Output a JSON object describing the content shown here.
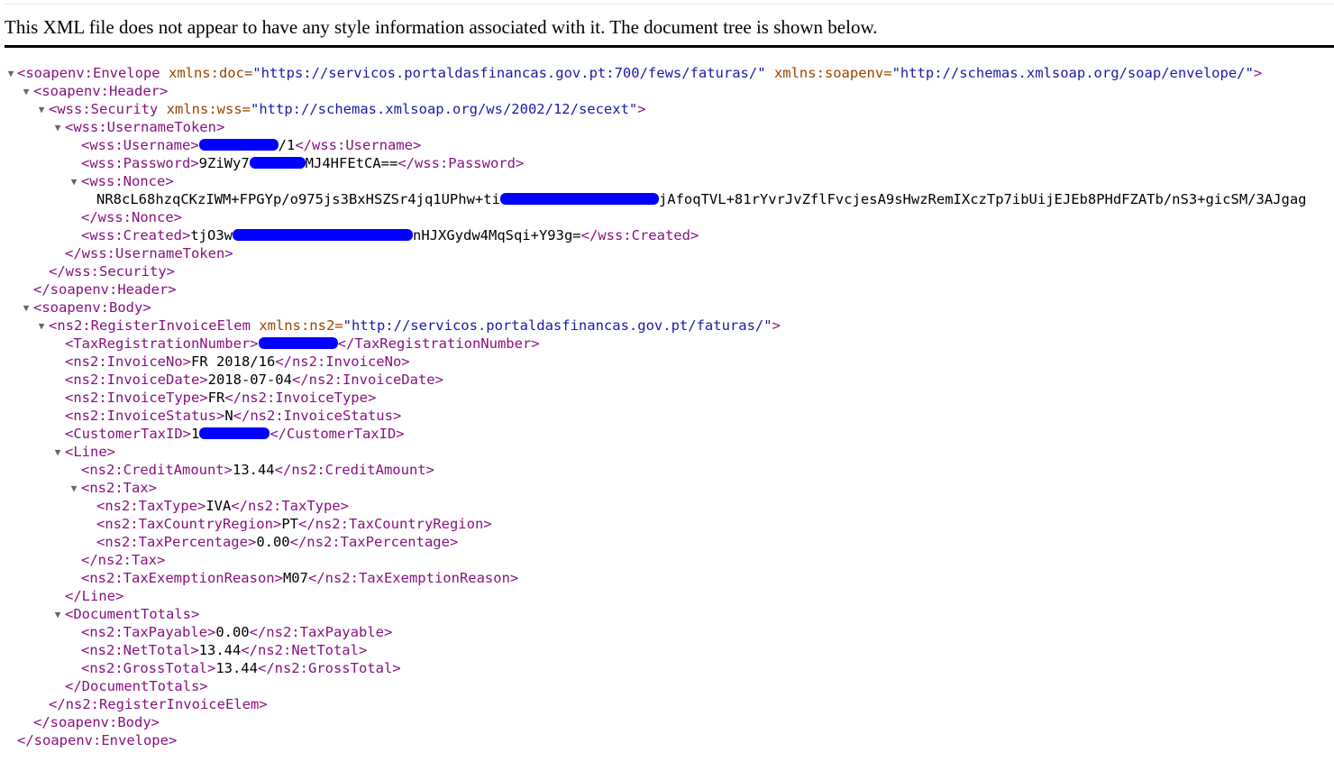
{
  "banner": "This XML file does not appear to have any style information associated with it. The document tree is shown below.",
  "xml": {
    "envelope_open": "<soapenv:Envelope",
    "ns_doc_attr": "xmlns:doc=",
    "ns_doc_val": "\"https://servicos.portaldasfinancas.gov.pt:700/fews/faturas/\"",
    "ns_soapenv_attr": "xmlns:soapenv=",
    "ns_soapenv_val": "\"http://schemas.xmlsoap.org/soap/envelope/\"",
    "gt": ">",
    "header_open": "<soapenv:Header>",
    "security_open": "<wss:Security",
    "ns_wss_attr": "xmlns:wss=",
    "ns_wss_val": "\"http://schemas.xmlsoap.org/ws/2002/12/secext\"",
    "token_open": "<wss:UsernameToken>",
    "username_open": "<wss:Username>",
    "username_suffix": "/1",
    "username_close": "</wss:Username>",
    "password_open": "<wss:Password>",
    "password_prefix": "9ZiWy7",
    "password_suffix": "MJ4HFEtCA==",
    "password_close": "</wss:Password>",
    "nonce_open": "<wss:Nonce>",
    "nonce_prefix": "NR8cL68hzqCKzIWM+FPGYp/o975js3BxHSZSr4jq1UPhw+ti",
    "nonce_suffix": "jAfoqTVL+81rYvrJvZflFvcjesA9sHwzRemIXczTp7ibUijEJEb8PHdFZATb/nS3+gicSM/3AJgag",
    "nonce_close": "</wss:Nonce>",
    "created_open": "<wss:Created>",
    "created_prefix": "tjO3w",
    "created_suffix": "nHJXGydw4MqSqi+Y93g=",
    "created_close": "</wss:Created>",
    "token_close": "</wss:UsernameToken>",
    "security_close": "</wss:Security>",
    "header_close": "</soapenv:Header>",
    "body_open": "<soapenv:Body>",
    "register_open": "<ns2:RegisterInvoiceElem",
    "ns_ns2_attr": "xmlns:ns2=",
    "ns_ns2_val": "\"http://servicos.portaldasfinancas.gov.pt/faturas/\"",
    "taxreg_open": "<TaxRegistrationNumber>",
    "taxreg_close": "</TaxRegistrationNumber>",
    "invno_open": "<ns2:InvoiceNo>",
    "invno_value": "FR 2018/16",
    "invno_close": "</ns2:InvoiceNo>",
    "invdate_open": "<ns2:InvoiceDate>",
    "invdate_value": "2018-07-04",
    "invdate_close": "</ns2:InvoiceDate>",
    "invtype_open": "<ns2:InvoiceType>",
    "invtype_value": "FR",
    "invtype_close": "</ns2:InvoiceType>",
    "invstatus_open": "<ns2:InvoiceStatus>",
    "invstatus_value": "N",
    "invstatus_close": "</ns2:InvoiceStatus>",
    "custtax_open": "<CustomerTaxID>",
    "custtax_prefix": "1",
    "custtax_close": "</CustomerTaxID>",
    "line_open": "<Line>",
    "credit_open": "<ns2:CreditAmount>",
    "credit_value": "13.44",
    "credit_close": "</ns2:CreditAmount>",
    "tax_open": "<ns2:Tax>",
    "taxtype_open": "<ns2:TaxType>",
    "taxtype_value": "IVA",
    "taxtype_close": "</ns2:TaxType>",
    "taxcountry_open": "<ns2:TaxCountryRegion>",
    "taxcountry_value": "PT",
    "taxcountry_close": "</ns2:TaxCountryRegion>",
    "taxpct_open": "<ns2:TaxPercentage>",
    "taxpct_value": "0.00",
    "taxpct_close": "</ns2:TaxPercentage>",
    "tax_close": "</ns2:Tax>",
    "exemption_open": "<ns2:TaxExemptionReason>",
    "exemption_value": "M07",
    "exemption_close": "</ns2:TaxExemptionReason>",
    "line_close": "</Line>",
    "doctotals_open": "<DocumentTotals>",
    "taxpayable_open": "<ns2:TaxPayable>",
    "taxpayable_value": "0.00",
    "taxpayable_close": "</ns2:TaxPayable>",
    "nettotal_open": "<ns2:NetTotal>",
    "nettotal_value": "13.44",
    "nettotal_close": "</ns2:NetTotal>",
    "grosstotal_open": "<ns2:GrossTotal>",
    "grosstotal_value": "13.44",
    "grosstotal_close": "</ns2:GrossTotal>",
    "doctotals_close": "</DocumentTotals>",
    "register_close": "</ns2:RegisterInvoiceElem>",
    "body_close": "</soapenv:Body>",
    "envelope_close": "</soapenv:Envelope>"
  },
  "icons": {
    "toggle": "▼"
  },
  "colors": {
    "tag": "#881280",
    "attribute": "#994500",
    "value": "#1a1aa6",
    "redaction": "#0000ff"
  }
}
